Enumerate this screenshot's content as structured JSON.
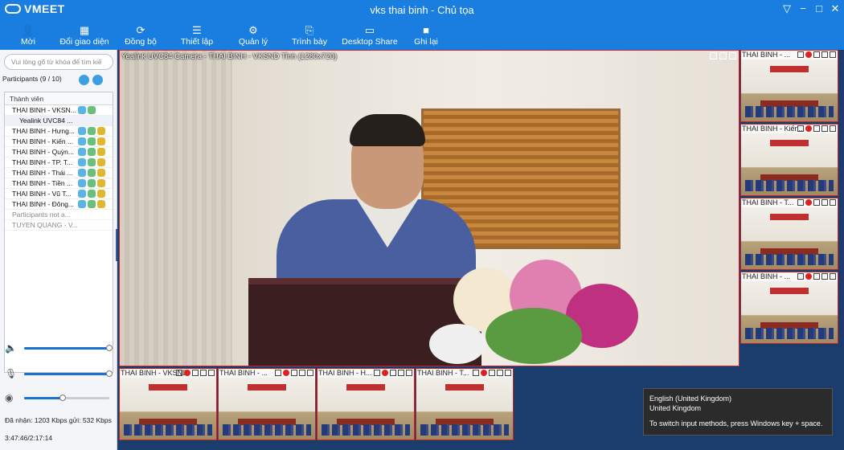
{
  "app": {
    "logo": "VMEET",
    "window_title": "vks thai binh - Chủ tọa",
    "window_controls": {
      "menu": "▽",
      "minimize": "−",
      "maximize": "□",
      "close": "✕"
    }
  },
  "toolbar": [
    {
      "key": "moi",
      "label": "Mời",
      "icon": "user-add-icon",
      "glyph": "👤",
      "width": 70
    },
    {
      "key": "doi",
      "label": "Đổi giao diện",
      "icon": "layout-icon",
      "glyph": "▦",
      "width": 70
    },
    {
      "key": "dongbo",
      "label": "Đồng bộ",
      "icon": "sync-icon",
      "glyph": "⟳",
      "width": 70
    },
    {
      "key": "thietlap",
      "label": "Thiết lập",
      "icon": "settings-sliders-icon",
      "glyph": "☰",
      "width": 70
    },
    {
      "key": "quanly",
      "label": "Quản lý",
      "icon": "gear-icon",
      "glyph": "⚙",
      "width": 70
    },
    {
      "key": "trinhbay",
      "label": "Trình bày",
      "icon": "present-icon",
      "glyph": "⎘",
      "width": 70
    },
    {
      "key": "desktop",
      "label": "Desktop Share",
      "icon": "desktop-share-icon",
      "glyph": "▭",
      "width": 70
    },
    {
      "key": "ghilai",
      "label": "Ghi lại",
      "icon": "record-icon",
      "glyph": "■",
      "width": 70
    }
  ],
  "sidebar": {
    "search_placeholder": "Vui lòng gõ từ khóa để tìm kiế",
    "participants_label": "Participants (9 / 10)",
    "column_header": "Thành viên",
    "participants": [
      {
        "name": "THAI BINH - VKSN...",
        "type": "main",
        "icons": 2
      },
      {
        "name": "Yealink UVC84 ...",
        "type": "sub",
        "icons": 0
      },
      {
        "name": "THAI BINH - Hưng...",
        "type": "main",
        "icons": 3
      },
      {
        "name": "THAI BINH - Kiến ...",
        "type": "main",
        "icons": 3
      },
      {
        "name": "THAI BINH - Quỳn...",
        "type": "main",
        "icons": 3
      },
      {
        "name": "THAI BINH - TP. T...",
        "type": "main",
        "icons": 3
      },
      {
        "name": "THAI BINH - Thái ...",
        "type": "main",
        "icons": 3
      },
      {
        "name": "THAI BINH - Tiền ...",
        "type": "main",
        "icons": 3
      },
      {
        "name": "THAI BINH - Vũ T...",
        "type": "main",
        "icons": 3
      },
      {
        "name": "THAI BINH - Đông...",
        "type": "main",
        "icons": 3
      },
      {
        "name": "Participants not a...",
        "type": "gray",
        "icons": 0
      },
      {
        "name": "TUYEN QUANG - V...",
        "type": "gray",
        "icons": 0
      }
    ],
    "sliders": [
      {
        "name": "speaker-volume",
        "icon": "speaker-icon",
        "glyph": "🔈",
        "level": 1.0
      },
      {
        "name": "mic-volume",
        "icon": "microphone-icon",
        "glyph": "🎙",
        "level": 1.0
      },
      {
        "name": "camera-level",
        "icon": "camera-icon",
        "glyph": "◉",
        "level": 0.45
      }
    ],
    "bandwidth": "Đã nhận: 1203 Kbps gửi: 532 Kbps",
    "timer": "3:47:46/2:17:14"
  },
  "main_video": {
    "caption": "Yealink UVC84 Camera - THAI BINH - VKSND Tỉnh (1280x720)"
  },
  "right_thumbs": [
    {
      "label": "THAI BINH - ..."
    },
    {
      "label": "THAI BINH - Kiến..."
    },
    {
      "label": "THAI BINH - T..."
    },
    {
      "label": "THAI BINH - ..."
    }
  ],
  "bottom_thumbs": [
    {
      "label": "THAI BINH - VKSND"
    },
    {
      "label": "THAI BINH - ..."
    },
    {
      "label": "THAI BINH - H..."
    },
    {
      "label": "THAI BINH - T..."
    }
  ],
  "tooltip": {
    "line1": "English (United Kingdom)",
    "line2": "United Kingdom",
    "line3": "To switch input methods, press Windows key + space."
  }
}
